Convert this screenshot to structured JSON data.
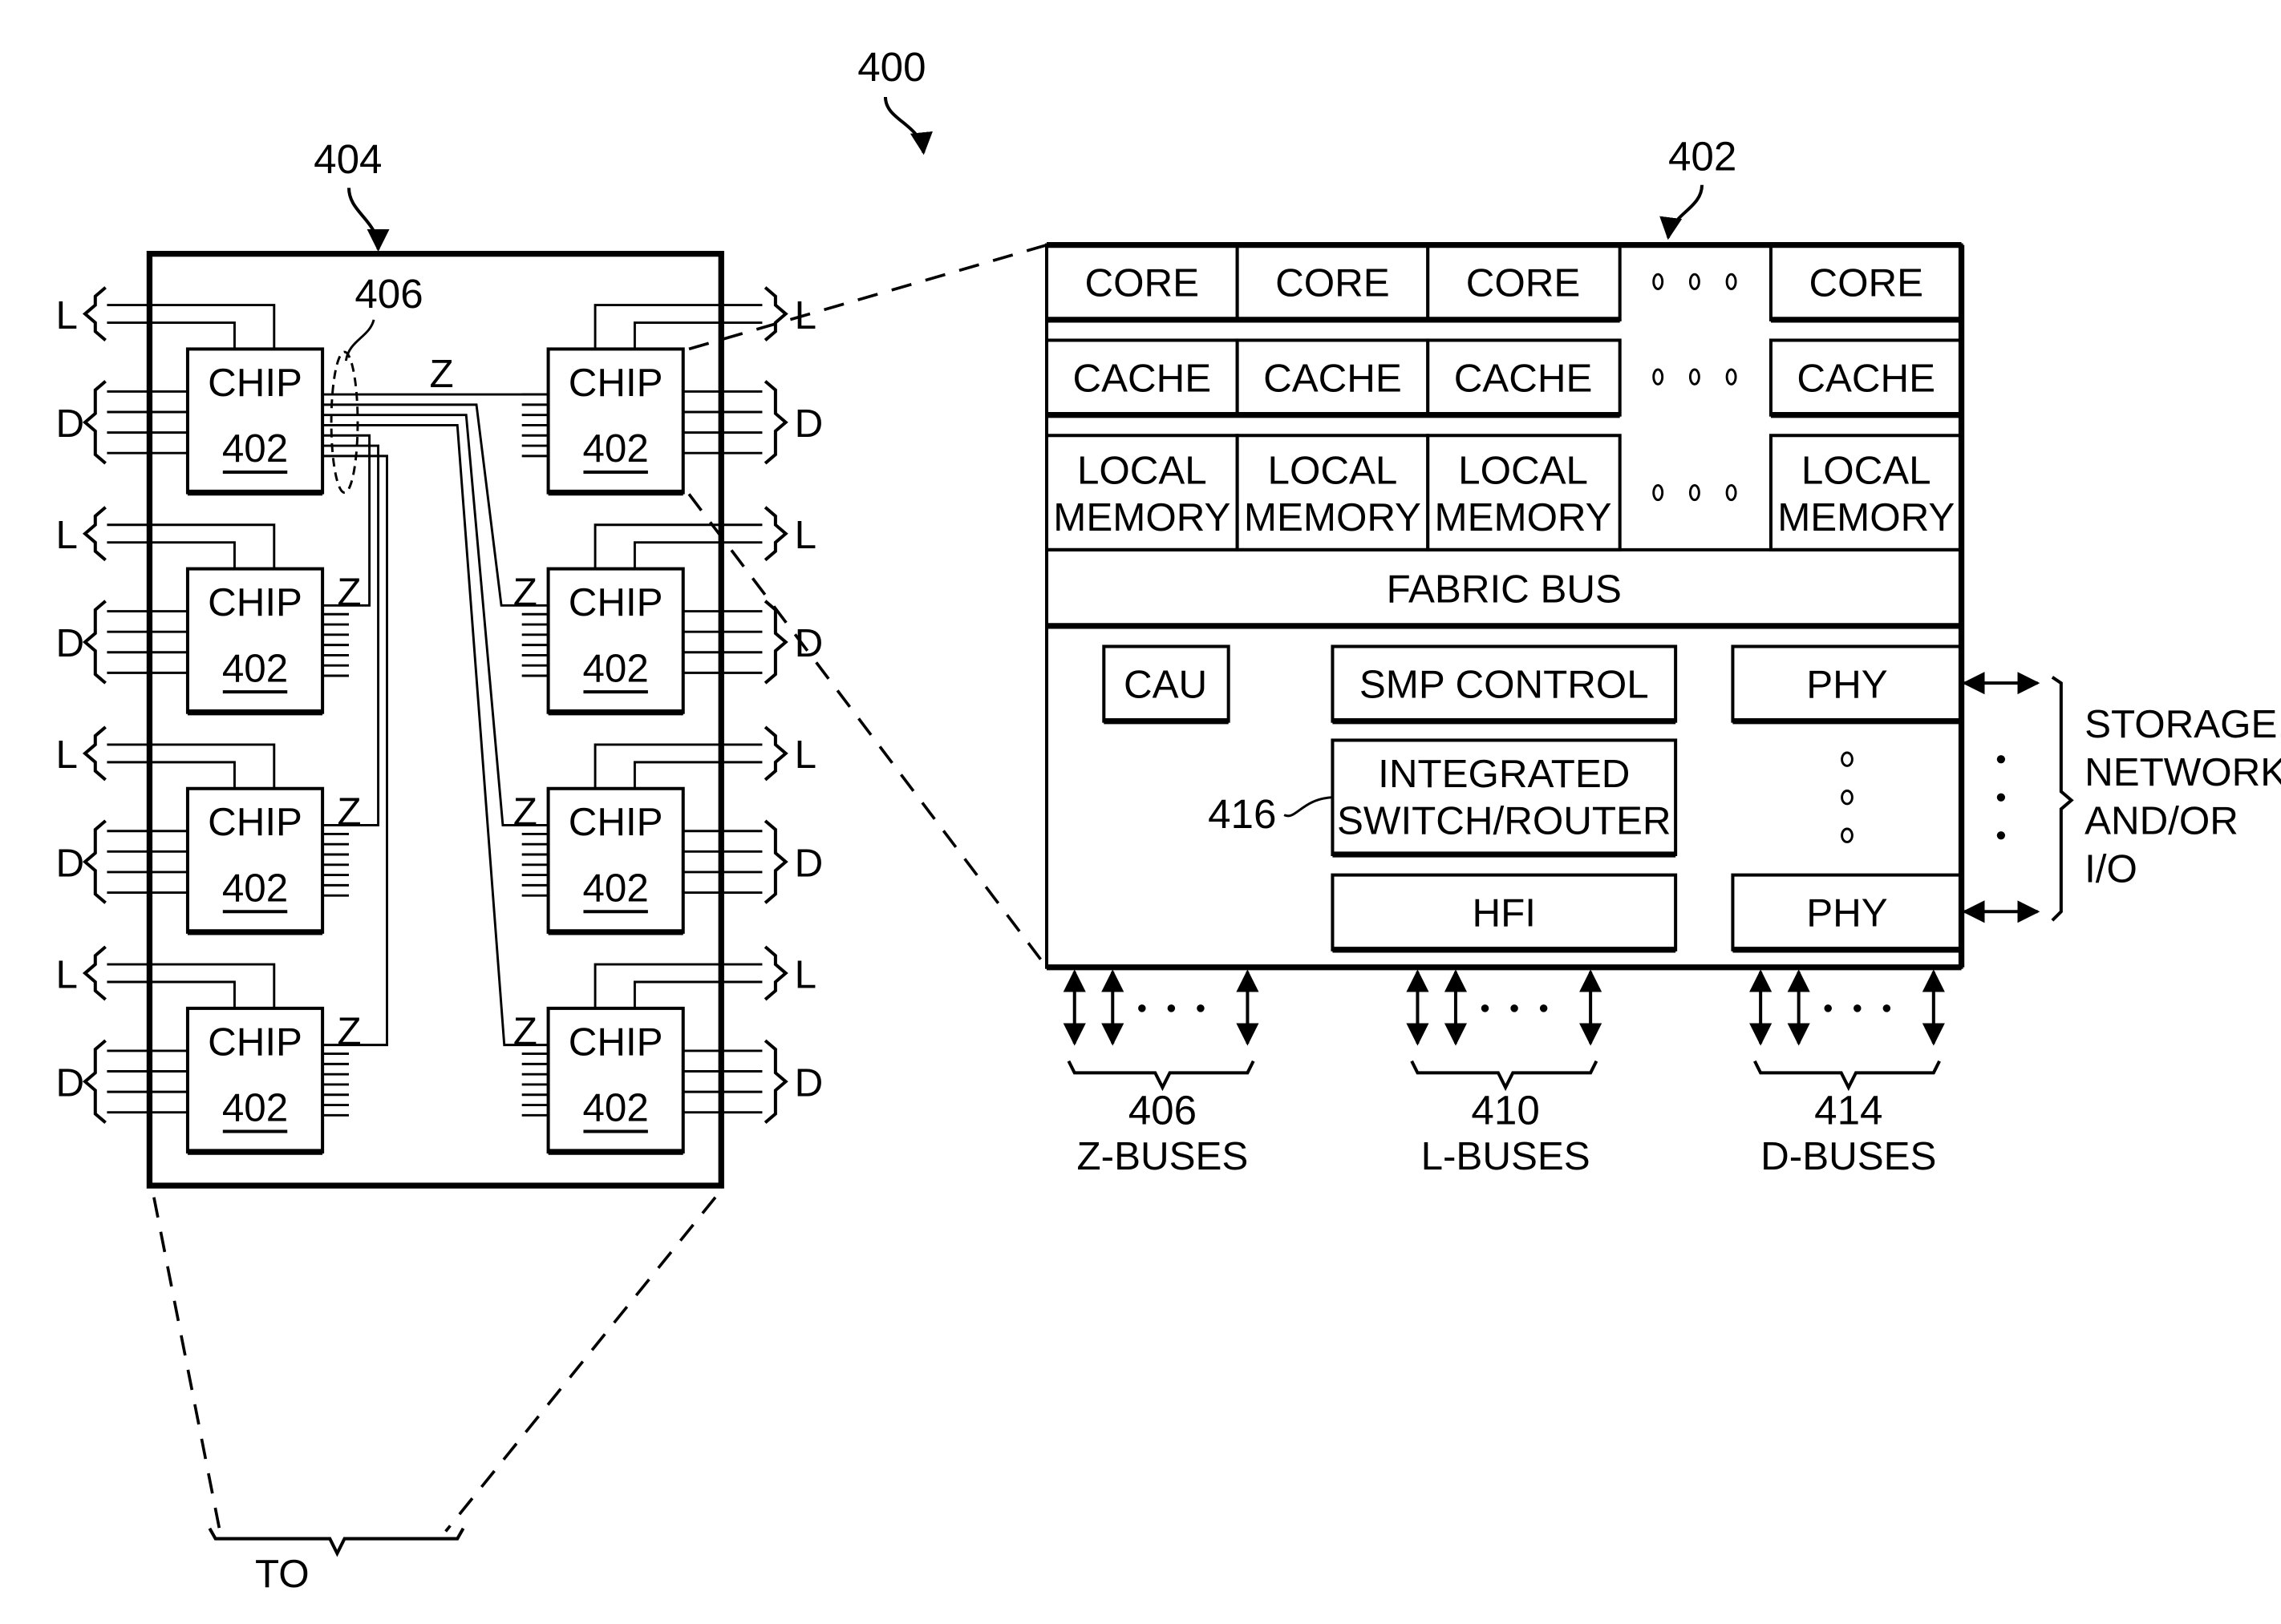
{
  "figure": {
    "ref_main": "400",
    "ref_module": "404",
    "ref_chip_detail": "402",
    "ref_z_group": "406",
    "ref_switch": "416"
  },
  "module": {
    "chip_label": "CHIP",
    "chip_ref": "402",
    "chips_per_column": 4,
    "bus_labels": {
      "L": "L",
      "D": "D",
      "Z": "Z"
    },
    "bottom_label": "TO"
  },
  "chip_detail": {
    "cores": [
      "CORE",
      "CORE",
      "CORE",
      "CORE"
    ],
    "caches": [
      "CACHE",
      "CACHE",
      "CACHE",
      "CACHE"
    ],
    "local_memory_line1": "LOCAL",
    "local_memory_line2": "MEMORY",
    "fabric_bus": "FABRIC BUS",
    "cau": "CAU",
    "smp_control": "SMP CONTROL",
    "switch_line1": "INTEGRATED",
    "switch_line2": "SWITCH/ROUTER",
    "hfi": "HFI",
    "phy_top": "PHY",
    "phy_bottom": "PHY",
    "io_lines": [
      "STORAGE,",
      "NETWORK,",
      "AND/OR",
      "I/O"
    ]
  },
  "buses": [
    {
      "ref": "406",
      "name": "Z-BUSES"
    },
    {
      "ref": "410",
      "name": "L-BUSES"
    },
    {
      "ref": "414",
      "name": "D-BUSES"
    }
  ]
}
